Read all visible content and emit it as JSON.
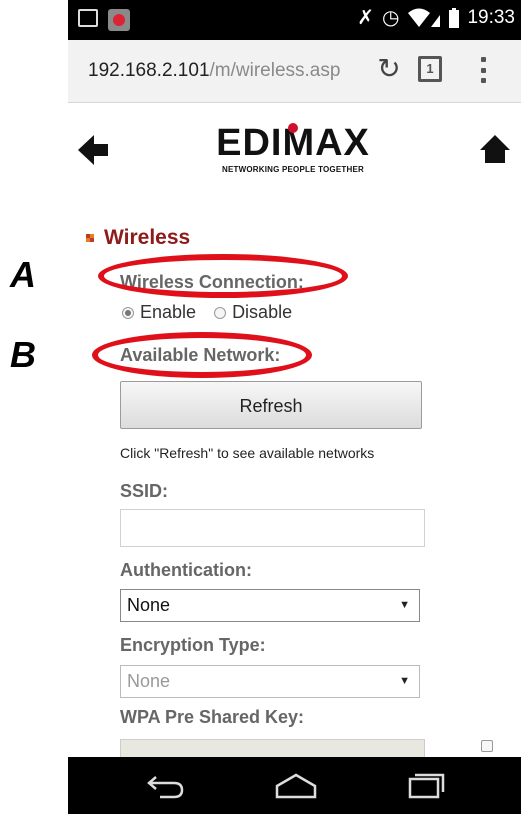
{
  "annotations": {
    "a": "A",
    "b": "B"
  },
  "status_bar": {
    "time": "19:33"
  },
  "browser": {
    "url_host": "192.168.2.101",
    "url_path": "/m/wireless.asp",
    "tab_count": "1"
  },
  "logo": {
    "wordmark": "EDIMAX",
    "tagline": "NETWORKING PEOPLE TOGETHER"
  },
  "section": {
    "title": "Wireless"
  },
  "form": {
    "wireless_connection_label": "Wireless Connection:",
    "enable_label": "Enable",
    "disable_label": "Disable",
    "enabled_selected": true,
    "available_network_label": "Available Network:",
    "refresh_label": "Refresh",
    "refresh_hint": "Click \"Refresh\" to see available networks",
    "ssid_label": "SSID:",
    "ssid_value": "",
    "authentication_label": "Authentication:",
    "authentication_value": "None",
    "encryption_label": "Encryption Type:",
    "encryption_value": "None",
    "wpa_key_label": "WPA Pre Shared Key:"
  },
  "colors": {
    "accent_title": "#8f1a1a",
    "highlight_ellipse": "#e0101a",
    "logo_red": "#d0102a"
  },
  "icons": [
    "back-arrow-icon",
    "home-icon",
    "reload-icon",
    "tabs-icon",
    "overflow-menu-icon",
    "nav-back-icon",
    "nav-home-icon",
    "nav-recents-icon"
  ]
}
